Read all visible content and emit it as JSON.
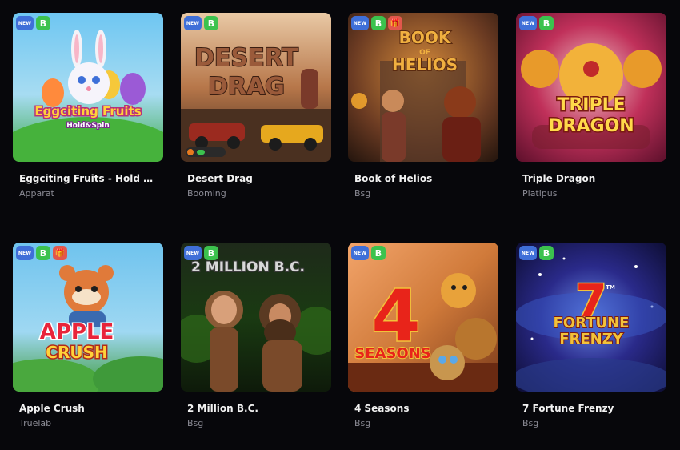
{
  "colors": {
    "page_bg": "#07070b",
    "badge_new": "#3f6fd8",
    "badge_btc": "#3cc24e",
    "badge_gift": "#e2574c",
    "title": "#f2f2f2",
    "provider": "#8c8c96"
  },
  "badges": {
    "new_label": "NEW",
    "btc_label": "B",
    "gift_label": "🎁"
  },
  "games": [
    {
      "title": "Eggciting Fruits - Hold & ...",
      "provider": "Apparat",
      "badges": [
        "new",
        "btc"
      ],
      "art_text": [
        "Eggciting Fruits",
        "Hold&Spin"
      ],
      "icons": [
        "easter-bunny-icon"
      ]
    },
    {
      "title": "Desert Drag",
      "provider": "Booming",
      "badges": [
        "new",
        "btc"
      ],
      "art_text": [
        "DESERT",
        "DRAG"
      ],
      "icons": [
        "racing-car-icon"
      ]
    },
    {
      "title": "Book of Helios",
      "provider": "Bsg",
      "badges": [
        "new",
        "btc",
        "gift"
      ],
      "art_text": [
        "BOOK",
        "OF",
        "HELIOS"
      ],
      "icons": [
        "warrior-icon"
      ]
    },
    {
      "title": "Triple Dragon",
      "provider": "Platipus",
      "badges": [
        "new",
        "btc"
      ],
      "art_text": [
        "TRIPLE",
        "DRAGON"
      ],
      "icons": [
        "dragon-icon"
      ]
    },
    {
      "title": "Apple Crush",
      "provider": "Truelab",
      "badges": [
        "new",
        "btc",
        "gift"
      ],
      "art_text": [
        "APPLE",
        "CRUSH"
      ],
      "icons": [
        "raccoon-icon"
      ]
    },
    {
      "title": "2 Million B.C.",
      "provider": "Bsg",
      "badges": [
        "new",
        "btc"
      ],
      "art_text": [
        "2 MILLION B.C."
      ],
      "icons": [
        "caveman-icon"
      ]
    },
    {
      "title": "4 Seasons",
      "provider": "Bsg",
      "badges": [
        "new",
        "btc"
      ],
      "art_text": [
        "4",
        "SEASONS"
      ],
      "icons": [
        "animals-icon"
      ]
    },
    {
      "title": "7 Fortune Frenzy",
      "provider": "Bsg",
      "badges": [
        "new",
        "btc"
      ],
      "art_text": [
        "7",
        "TM",
        "FORTUNE",
        "FRENZY"
      ],
      "icons": [
        "lucky-seven-icon"
      ]
    }
  ]
}
